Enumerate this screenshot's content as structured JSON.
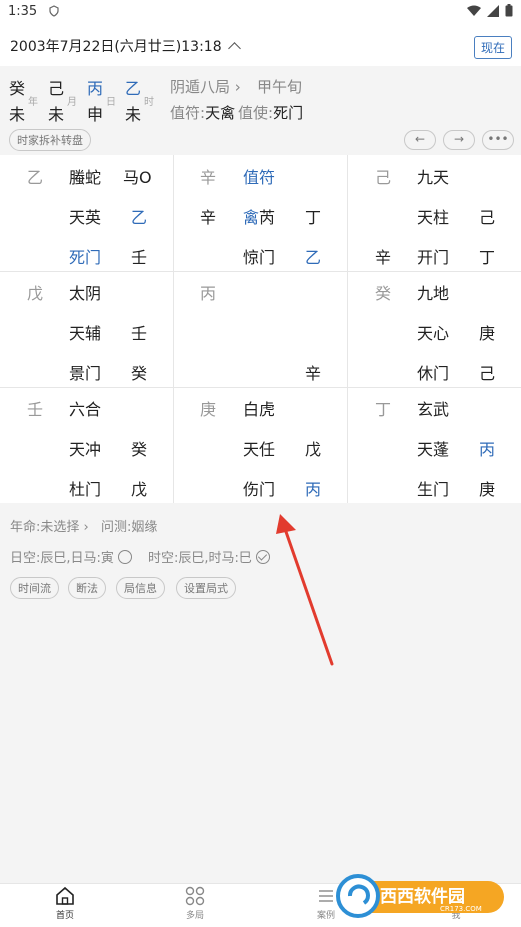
{
  "status": {
    "time": "1:35"
  },
  "header": {
    "date": "2003年7月22日(六月廿三)13:18",
    "now_label": "现在"
  },
  "pillars": [
    {
      "stem": "癸",
      "branch": "未",
      "sub": "年",
      "stem_color": "#222222"
    },
    {
      "stem": "己",
      "branch": "未",
      "sub": "月",
      "stem_color": "#222222"
    },
    {
      "stem": "丙",
      "branch": "申",
      "sub": "日",
      "stem_color": "#2f6bb8"
    },
    {
      "stem": "乙",
      "branch": "未",
      "sub": "时",
      "stem_color": "#2f6bb8"
    }
  ],
  "ju": {
    "name": "阴遁八局",
    "xun": "甲午旬",
    "zhifu_label": "值符:",
    "zhifu": "天禽",
    "zhishi_label": "值使:",
    "zhishi": "死门"
  },
  "buttons": {
    "chaibu": "时家拆补转盘",
    "prev": "←",
    "next": "→",
    "more": "•••"
  },
  "palaces": [
    {
      "stem": "乙",
      "god": "螣蛇",
      "extra": "马O",
      "star": "天英",
      "star_stem": "乙",
      "door": "死门",
      "door_stem": "壬",
      "god_color": "#222222",
      "door_color": "#2f6bb8",
      "star_stem_color": "#2f6bb8"
    },
    {
      "stem": "辛",
      "god": "值符",
      "extra": "",
      "left_stem": "辛",
      "star": "禽芮",
      "star_stem": "丁",
      "door": "惊门",
      "door_stem": "乙",
      "god_color": "#2f6bb8",
      "door_color": "#222222",
      "door_stem_color": "#2f6bb8"
    },
    {
      "stem": "己",
      "god": "九天",
      "star": "天柱",
      "star_stem": "己",
      "left_stem": "辛",
      "door": "开门",
      "door_stem": "丁"
    },
    {
      "stem": "戊",
      "god": "太阴",
      "star": "天辅",
      "star_stem": "壬",
      "door": "景门",
      "door_stem": "癸"
    },
    {
      "stem": "丙",
      "bottom_stem": "辛"
    },
    {
      "stem": "癸",
      "god": "九地",
      "star": "天心",
      "star_stem": "庚",
      "door": "休门",
      "door_stem": "己"
    },
    {
      "stem": "壬",
      "god": "六合",
      "star": "天冲",
      "star_stem": "癸",
      "door": "杜门",
      "door_stem": "戊"
    },
    {
      "stem": "庚",
      "god": "白虎",
      "star": "天任",
      "star_stem": "戊",
      "door": "伤门",
      "door_stem": "丙",
      "door_stem_color": "#2f6bb8"
    },
    {
      "stem": "丁",
      "god": "玄武",
      "star": "天蓬",
      "star_stem": "丙",
      "door": "生门",
      "door_stem": "庚",
      "star_stem_color": "#2f6bb8"
    }
  ],
  "panel": {
    "nianming": "年命:未选择",
    "wence": "问测:姻缘",
    "rikong": "日空:辰巳,日马:寅",
    "shikong": "时空:辰巳,时马:巳",
    "actions": [
      "时间流",
      "断法",
      "局信息",
      "设置局式"
    ]
  },
  "tabs": [
    "首页",
    "多局",
    "案例",
    "我"
  ],
  "watermark": {
    "text": "西西软件园",
    "sub": "CR173.COM"
  },
  "colors": {
    "accent": "#2f6bb8",
    "arrow": "#e23b2e"
  }
}
